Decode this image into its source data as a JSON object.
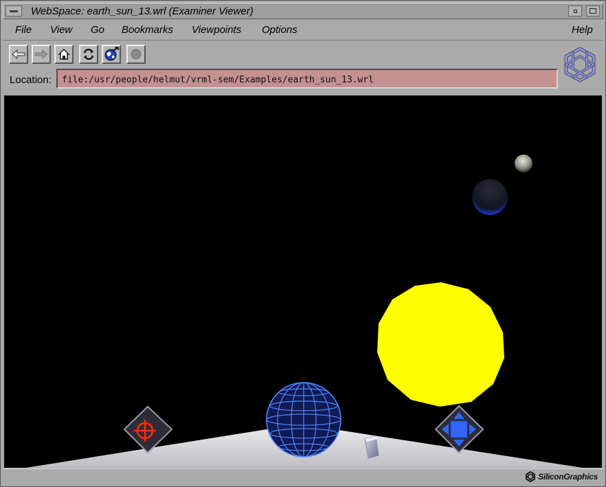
{
  "window": {
    "title": "WebSpace: earth_sun_13.wrl (Examiner Viewer)"
  },
  "menubar": {
    "file": "File",
    "view": "View",
    "go": "Go",
    "bookmarks": "Bookmarks",
    "viewpoints": "Viewpoints",
    "options": "Options",
    "help": "Help"
  },
  "toolbar": {
    "buttons": [
      "back-arrow-icon",
      "forward-arrow-icon",
      "home-icon",
      "reload-icon",
      "globe-icon",
      "stop-icon"
    ]
  },
  "location": {
    "label": "Location:",
    "value": "file:/usr/people/helmut/vrml-sem/Examples/earth_sun_13.wrl"
  },
  "status": {
    "brand": "SiliconGraphics"
  },
  "colors": {
    "sun": "#ffff00",
    "location_field": "#c49090",
    "viewport_bg": "#000000",
    "navigator_blue": "#3355ee",
    "target_red": "#ff2200"
  }
}
